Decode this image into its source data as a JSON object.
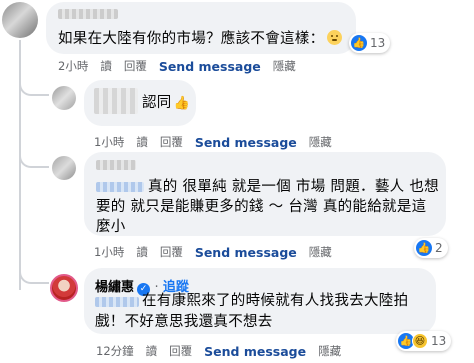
{
  "comments": [
    {
      "text": "如果在大陸有你的市場？應該不會這樣：",
      "reaction_count": "13",
      "actions": {
        "time": "2小時",
        "read": "讀",
        "reply": "回覆",
        "send": "Send message",
        "hide": "隱藏"
      }
    },
    {
      "text": "認同",
      "actions": {
        "time": "1小時",
        "read": "讀",
        "reply": "回覆",
        "send": "Send message",
        "hide": "隱藏"
      }
    },
    {
      "line1": "真的 很單純 就是一個 市場 問題．藝人 也想",
      "line2": "要的 就只是能賺更多的錢 ～ 台灣 真的能給就是這",
      "line3": "麼小",
      "reaction_count": "2",
      "actions": {
        "time": "1小時",
        "read": "讀",
        "reply": "回覆",
        "send": "Send message",
        "hide": "隱藏"
      }
    },
    {
      "author": "楊繡惠",
      "follow": "追蹤",
      "line1": "在有康熙來了的時候就有人找我去大陸拍",
      "line2": "戲！不好意思我還真不想去",
      "reaction_count": "13",
      "actions": {
        "time": "12分鐘",
        "read": "讀",
        "reply": "回覆",
        "send": "Send message",
        "hide": "隱藏"
      }
    }
  ]
}
